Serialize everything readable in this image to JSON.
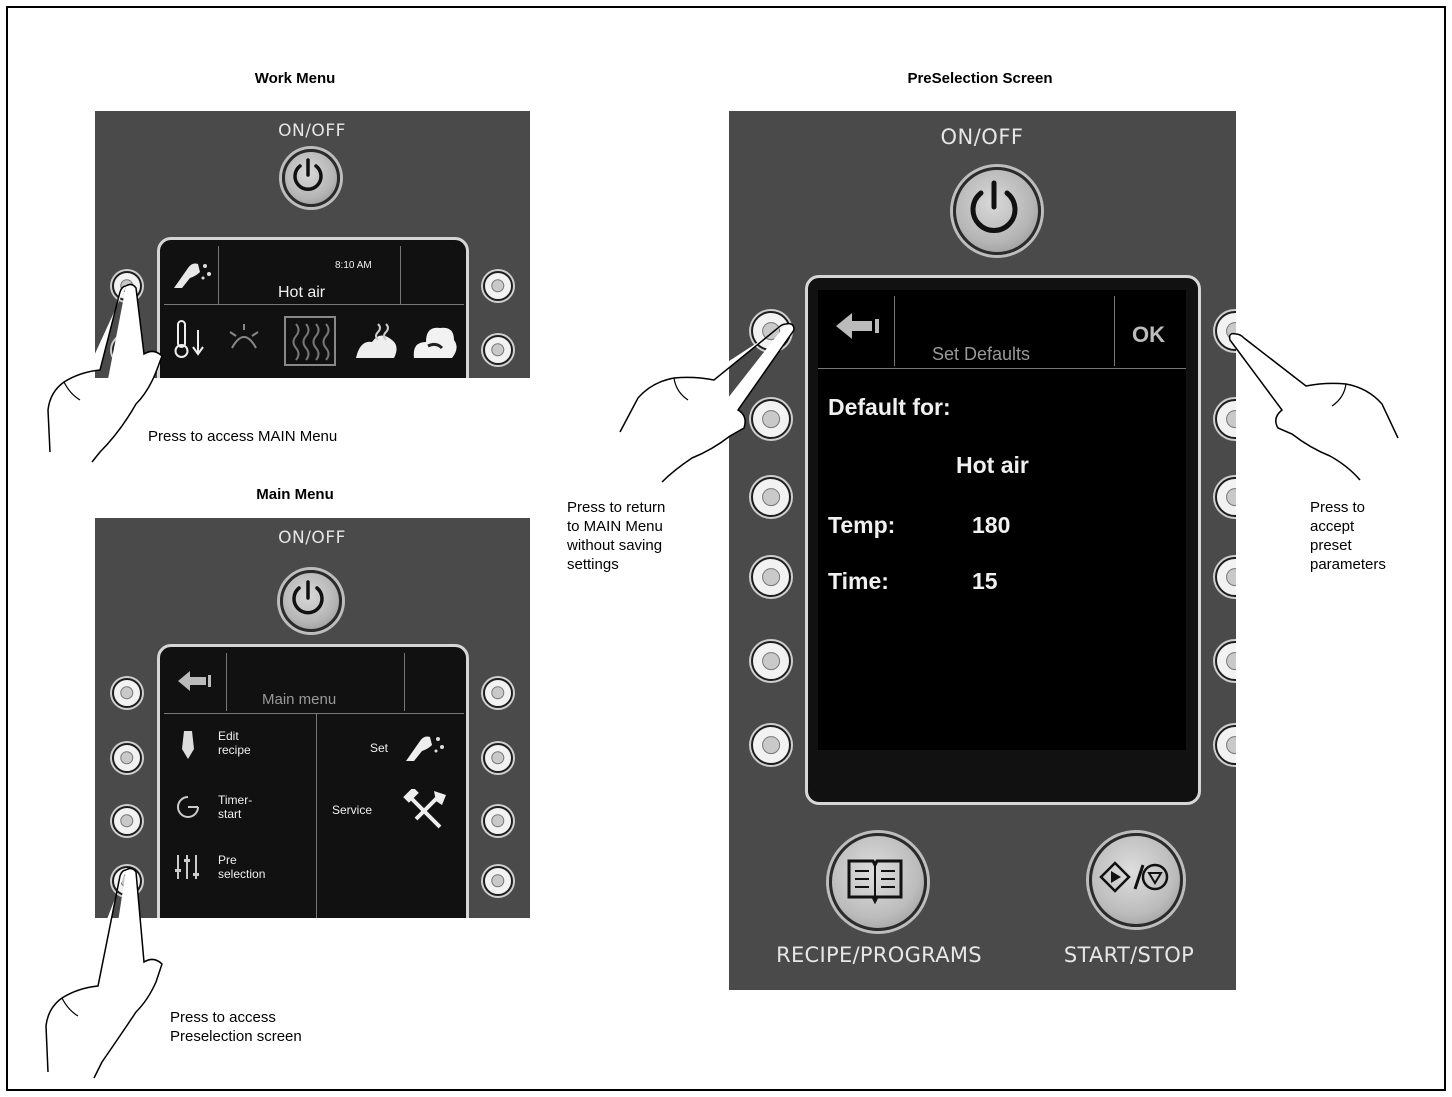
{
  "work_menu": {
    "title": "Work Menu",
    "onoff": "ON/OFF",
    "time": "8:10 AM",
    "mode": "Hot air",
    "annotation": "Press to access MAIN Menu"
  },
  "main_menu": {
    "title": "Main Menu",
    "onoff": "ON/OFF",
    "header": "Main menu",
    "items_left": [
      {
        "line1": "Edit",
        "line2": "recipe",
        "icon": "pastry-bag-icon"
      },
      {
        "line1": "Timer-",
        "line2": "start",
        "icon": "timer-icon"
      },
      {
        "line1": "Pre",
        "line2": "selection",
        "icon": "sliders-icon"
      }
    ],
    "items_right": [
      {
        "label": "Set",
        "icon": "hand-settings-icon"
      },
      {
        "label": "Service",
        "icon": "tools-icon"
      }
    ],
    "annotation_line1": "Press to access",
    "annotation_line2": "Preselection screen"
  },
  "preselection": {
    "title": "PreSelection Screen",
    "onoff": "ON/OFF",
    "header": "Set Defaults",
    "ok": "OK",
    "default_for": "Default for:",
    "mode": "Hot air",
    "temp_label": "Temp:",
    "temp_value": "180",
    "time_label": "Time:",
    "time_value": "15",
    "recipe_label": "RECIPE/PROGRAMS",
    "start_label": "START/STOP",
    "annotation_left": [
      "Press to return",
      "to MAIN Menu",
      "without saving",
      "settings"
    ],
    "annotation_right": [
      "Press to",
      "accept",
      "preset",
      "parameters"
    ]
  }
}
